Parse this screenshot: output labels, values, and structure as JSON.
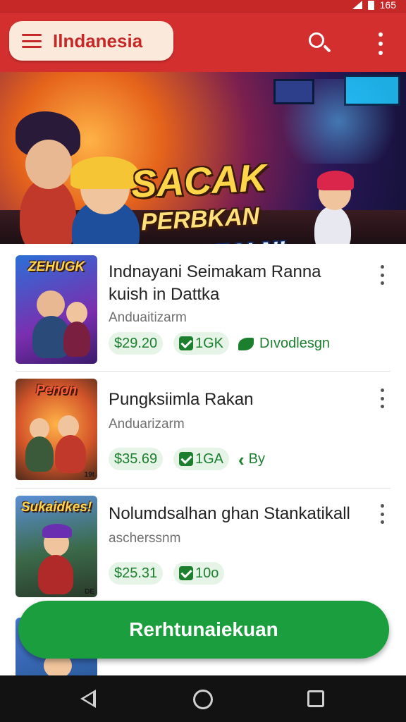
{
  "status_bar": {
    "time": "165"
  },
  "app_bar": {
    "region_label": "Ilndanesia",
    "menu_icon": "menu-icon",
    "search_icon": "search-icon",
    "more_icon": "more-vert-icon"
  },
  "banner": {
    "line1": "SACAK",
    "line2": "PERBKAN",
    "line3": "PERBAIMIALN!"
  },
  "items": [
    {
      "thumb_title": "ZEHUGK",
      "title": "Indnayani Seimakam Ranna kuish in Dattka",
      "developer": "Anduaitizarm",
      "price": "$29.20",
      "count": "1GK",
      "tag": "Dıvodlesgn",
      "tag_icon": "leaf-icon"
    },
    {
      "thumb_title": "Penon",
      "thumb_corner": "19t",
      "title": "Pungksiimla Rakan",
      "developer": "Anduarizarm",
      "price": "$35.69",
      "count": "1GA",
      "tag": "By",
      "tag_icon": "chevron-left-icon"
    },
    {
      "thumb_title": "Sukaidkes!",
      "thumb_corner": "DE",
      "title": "Nolumdsalhan ghan Stankatikall",
      "developer": "ascherssnm",
      "price": "$25.31",
      "count": "10o"
    }
  ],
  "fab": {
    "label": "Rerhtunaiekuan"
  },
  "colors": {
    "primary": "#d32f2f",
    "accent": "#1b9e3e",
    "price_bg": "#e6f3e7"
  }
}
